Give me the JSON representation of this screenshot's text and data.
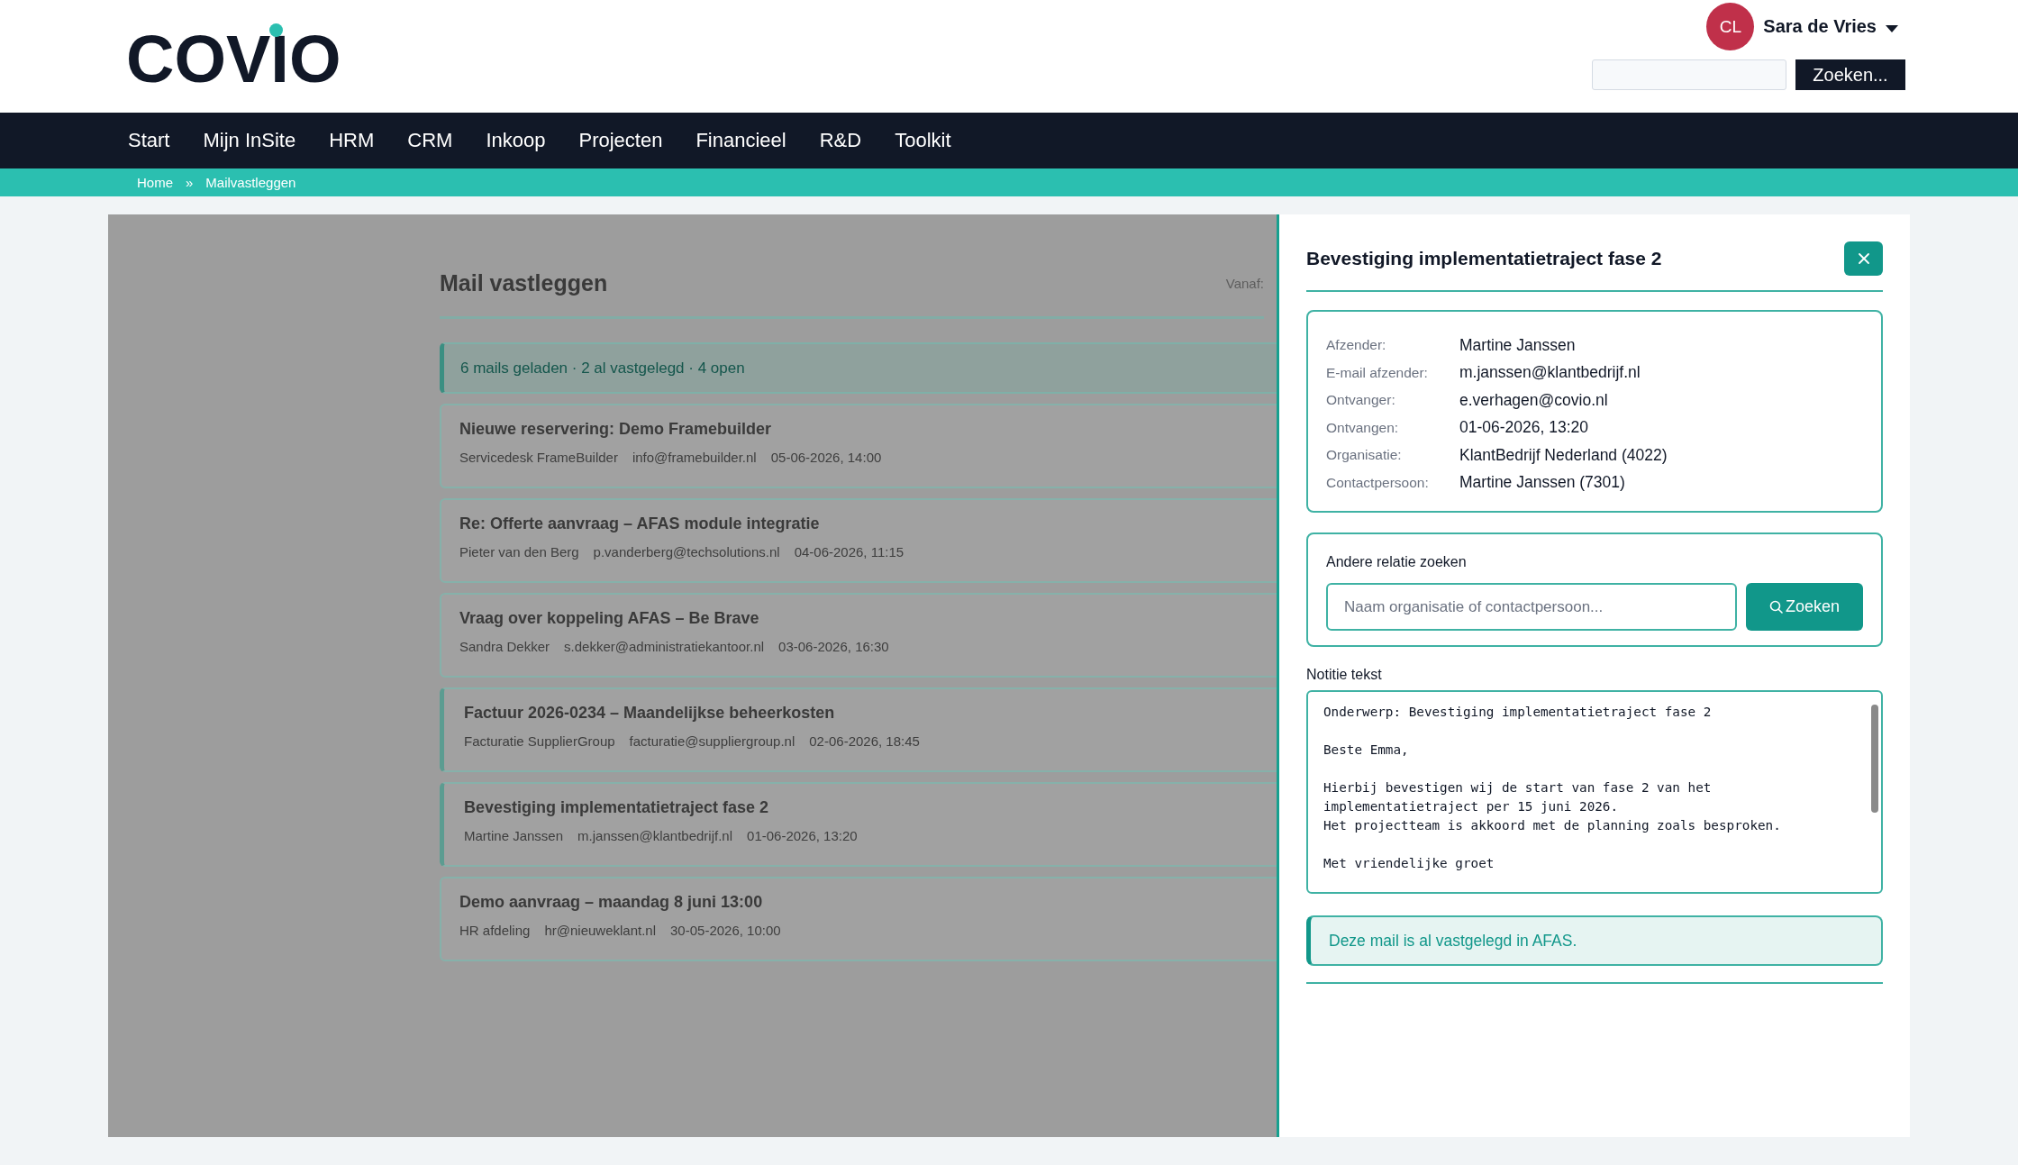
{
  "logo": {
    "text": "COVIO"
  },
  "user": {
    "initials": "CL",
    "name": "Sara de Vries"
  },
  "header_search": {
    "button": "Zoeken..."
  },
  "nav": [
    {
      "label": "Start"
    },
    {
      "label": "Mijn InSite"
    },
    {
      "label": "HRM"
    },
    {
      "label": "CRM"
    },
    {
      "label": "Inkoop"
    },
    {
      "label": "Projecten"
    },
    {
      "label": "Financieel"
    },
    {
      "label": "R&D"
    },
    {
      "label": "Toolkit"
    }
  ],
  "breadcrumb": {
    "items": [
      "Home",
      "Mailvastleggen"
    ],
    "separator": "»"
  },
  "background_page": {
    "title": "Mail vastleggen",
    "filter_label": "Vanaf:",
    "summary": "6 mails geladen · 2 al vastgelegd · 4 open",
    "mails": [
      {
        "subject": "Nieuwe reservering: Demo Framebuilder",
        "sender": "Servicedesk FrameBuilder",
        "email": "info@framebuilder.nl",
        "received": "05-06-2026, 14:00",
        "recorded": false
      },
      {
        "subject": "Re: Offerte aanvraag – AFAS module integratie",
        "sender": "Pieter van den Berg",
        "email": "p.vanderberg@techsolutions.nl",
        "received": "04-06-2026, 11:15",
        "recorded": false
      },
      {
        "subject": "Vraag over koppeling AFAS – Be Brave",
        "sender": "Sandra Dekker",
        "email": "s.dekker@administratiekantoor.nl",
        "received": "03-06-2026, 16:30",
        "recorded": false
      },
      {
        "subject": "Factuur 2026-0234 – Maandelijkse beheerkosten",
        "sender": "Facturatie SupplierGroup",
        "email": "facturatie@suppliergroup.nl",
        "received": "02-06-2026, 18:45",
        "recorded": true
      },
      {
        "subject": "Bevestiging implementatietraject fase 2",
        "sender": "Martine Janssen",
        "email": "m.janssen@klantbedrijf.nl",
        "received": "01-06-2026, 13:20",
        "recorded": true
      },
      {
        "subject": "Demo aanvraag – maandag 8 juni 13:00",
        "sender": "HR afdeling",
        "email": "hr@nieuweklant.nl",
        "received": "30-05-2026, 10:00",
        "recorded": false
      }
    ]
  },
  "detail": {
    "title": "Bevestiging implementatietraject fase 2",
    "fields": [
      {
        "label": "Afzender:",
        "value": "Martine Janssen"
      },
      {
        "label": "E-mail afzender:",
        "value": "m.janssen@klantbedrijf.nl"
      },
      {
        "label": "Ontvanger:",
        "value": "e.verhagen@covio.nl"
      },
      {
        "label": "Ontvangen:",
        "value": "01-06-2026, 13:20"
      },
      {
        "label": "Organisatie:",
        "value": "KlantBedrijf Nederland (4022)"
      },
      {
        "label": "Contactpersoon:",
        "value": "Martine Janssen (7301)"
      }
    ],
    "relation_search": {
      "label": "Andere relatie zoeken",
      "placeholder": "Naam organisatie of contactpersoon...",
      "button": "Zoeken"
    },
    "note": {
      "label": "Notitie tekst",
      "paragraphs": [
        [
          "Onderwerp: Bevestiging implementatietraject fase 2"
        ],
        [
          "Beste Emma,"
        ],
        [
          "Hierbij bevestigen wij de start van fase 2 van het implementatietraject per 15 juni 2026.",
          "Het projectteam is akkoord met de planning zoals besproken."
        ],
        [
          "Met vriendelijke groet"
        ]
      ]
    },
    "status": "Deze mail is al vastgelegd in AFAS."
  }
}
